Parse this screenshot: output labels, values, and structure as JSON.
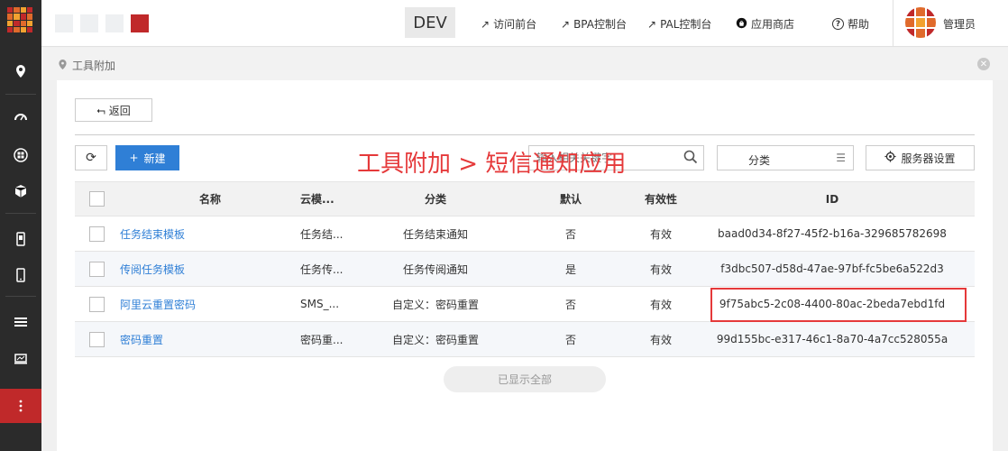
{
  "topbar": {
    "env": "DEV",
    "links": [
      {
        "icon": "external-link-icon",
        "label": "访问前台"
      },
      {
        "icon": "external-link-icon",
        "label": "BPA控制台"
      },
      {
        "icon": "external-link-icon",
        "label": "PAL控制台"
      },
      {
        "icon": "store-icon",
        "label": "应用商店"
      },
      {
        "icon": "help-icon",
        "label": "帮助"
      }
    ],
    "user": "管理员"
  },
  "breadcrumb": {
    "label": "工具附加"
  },
  "toolbar": {
    "back_label": "返回",
    "new_label": "新建",
    "search_placeholder": "输入相关关键字",
    "category_label": "分类",
    "server_settings_label": "服务器设置"
  },
  "overlay_title": "工具附加 > 短信通知应用",
  "table": {
    "headers": {
      "name": "名称",
      "cloud": "云模...",
      "category": "分类",
      "default": "默认",
      "valid": "有效性",
      "id": "ID"
    },
    "rows": [
      {
        "name": "任务结束模板",
        "cloud": "任务结...",
        "category": "任务结束通知",
        "default": "否",
        "valid": "有效",
        "id": "baad0d34-8f27-45f2-b16a-329685782698"
      },
      {
        "name": "传阅任务模板",
        "cloud": "任务传...",
        "category": "任务传阅通知",
        "default": "是",
        "valid": "有效",
        "id": "f3dbc507-d58d-47ae-97bf-fc5be6a522d3"
      },
      {
        "name": "阿里云重置密码",
        "cloud": "SMS_...",
        "category": "自定义：密码重置",
        "default": "否",
        "valid": "有效",
        "id": "9f75abc5-2c08-4400-80ac-2beda7ebd1fd"
      },
      {
        "name": "密码重置",
        "cloud": "密码重...",
        "category": "自定义：密码重置",
        "default": "否",
        "valid": "有效",
        "id": "99d155bc-e317-46c1-8a70-4a7cc528055a"
      }
    ],
    "highlighted_row": 2
  },
  "footer": {
    "show_all_label": "已显示全部"
  },
  "colors": {
    "accent": "#2f7fd6",
    "brand_red": "#c0292a",
    "highlight": "#e5393a",
    "nav_bg": "#2b2b2b"
  }
}
